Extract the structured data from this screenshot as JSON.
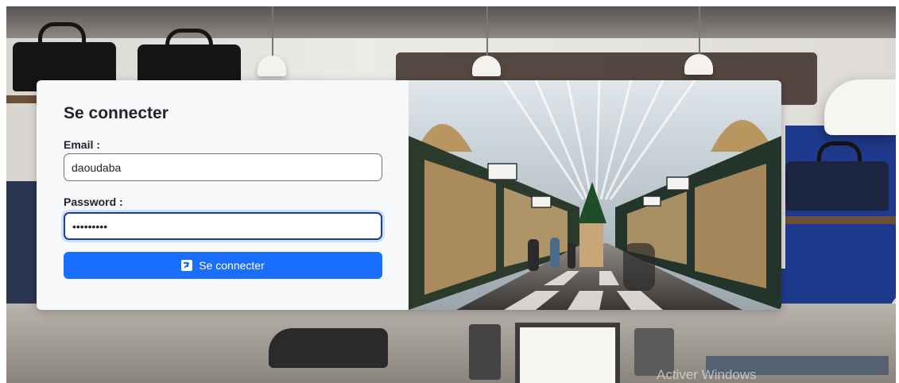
{
  "login": {
    "title": "Se connecter",
    "email_label": "Email :",
    "email_value": "daoudaba",
    "password_label": "Password :",
    "password_value": "•••••••••",
    "submit_label": "Se connecter"
  },
  "background": {
    "watermark": "Activer Windows"
  },
  "colors": {
    "primary": "#1a6efd",
    "card": "#f8f9fa",
    "focus_border": "#1d3f8f"
  }
}
